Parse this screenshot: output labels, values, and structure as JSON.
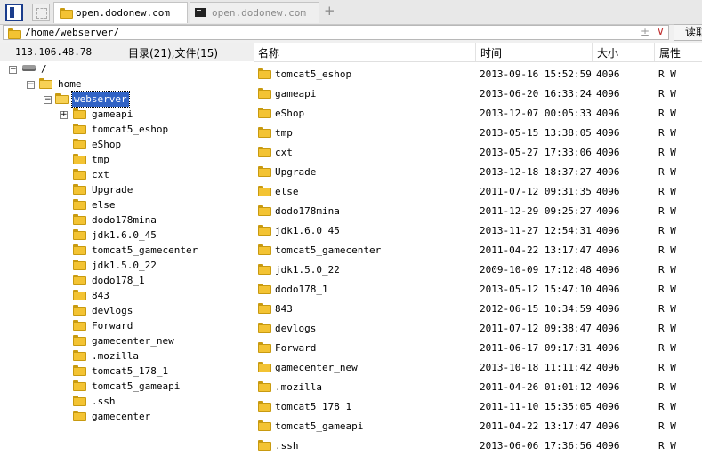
{
  "tabs": [
    {
      "label": "open.dodonew.com",
      "icon": "folder-icon",
      "active": true
    },
    {
      "label": "open.dodonew.com",
      "icon": "terminal-icon",
      "active": false
    }
  ],
  "path": {
    "value": "/home/webserver/",
    "symbol1": "±",
    "symbol2": "∨",
    "read_button": "读取"
  },
  "info": {
    "ip": "113.106.48.78",
    "stats": "目录(21),文件(15)"
  },
  "tree": {
    "root": "/",
    "home": "home",
    "current": "webserver",
    "children": [
      "gameapi",
      "tomcat5_eshop",
      "eShop",
      "tmp",
      "cxt",
      "Upgrade",
      "else",
      "dodo178mina",
      "jdk1.6.0_45",
      "tomcat5_gamecenter",
      "jdk1.5.0_22",
      "dodo178_1",
      "843",
      "devlogs",
      "Forward",
      "gamecenter_new",
      ".mozilla",
      "tomcat5_178_1",
      "tomcat5_gameapi",
      ".ssh",
      "gamecenter"
    ]
  },
  "columns": {
    "name": "名称",
    "time": "时间",
    "size": "大小",
    "attr": "属性"
  },
  "files": [
    {
      "name": "tomcat5_eshop",
      "time": "2013-09-16 15:52:59",
      "size": "4096",
      "attr": "R W"
    },
    {
      "name": "gameapi",
      "time": "2013-06-20 16:33:24",
      "size": "4096",
      "attr": "R W"
    },
    {
      "name": "eShop",
      "time": "2013-12-07 00:05:33",
      "size": "4096",
      "attr": "R W"
    },
    {
      "name": "tmp",
      "time": "2013-05-15 13:38:05",
      "size": "4096",
      "attr": "R W"
    },
    {
      "name": "cxt",
      "time": "2013-05-27 17:33:06",
      "size": "4096",
      "attr": "R W"
    },
    {
      "name": "Upgrade",
      "time": "2013-12-18 18:37:27",
      "size": "4096",
      "attr": "R W"
    },
    {
      "name": "else",
      "time": "2011-07-12 09:31:35",
      "size": "4096",
      "attr": "R W"
    },
    {
      "name": "dodo178mina",
      "time": "2011-12-29 09:25:27",
      "size": "4096",
      "attr": "R W"
    },
    {
      "name": "jdk1.6.0_45",
      "time": "2013-11-27 12:54:31",
      "size": "4096",
      "attr": "R W"
    },
    {
      "name": "tomcat5_gamecenter",
      "time": "2011-04-22 13:17:47",
      "size": "4096",
      "attr": "R W"
    },
    {
      "name": "jdk1.5.0_22",
      "time": "2009-10-09 17:12:48",
      "size": "4096",
      "attr": "R W"
    },
    {
      "name": "dodo178_1",
      "time": "2013-05-12 15:47:10",
      "size": "4096",
      "attr": "R W"
    },
    {
      "name": "843",
      "time": "2012-06-15 10:34:59",
      "size": "4096",
      "attr": "R W"
    },
    {
      "name": "devlogs",
      "time": "2011-07-12 09:38:47",
      "size": "4096",
      "attr": "R W"
    },
    {
      "name": "Forward",
      "time": "2011-06-17 09:17:31",
      "size": "4096",
      "attr": "R W"
    },
    {
      "name": "gamecenter_new",
      "time": "2013-10-18 11:11:42",
      "size": "4096",
      "attr": "R W"
    },
    {
      "name": ".mozilla",
      "time": "2011-04-26 01:01:12",
      "size": "4096",
      "attr": "R W"
    },
    {
      "name": "tomcat5_178_1",
      "time": "2011-11-10 15:35:05",
      "size": "4096",
      "attr": "R W"
    },
    {
      "name": "tomcat5_gameapi",
      "time": "2011-04-22 13:17:47",
      "size": "4096",
      "attr": "R W"
    },
    {
      "name": ".ssh",
      "time": "2013-06-06 17:36:56",
      "size": "4096",
      "attr": "R W"
    }
  ]
}
